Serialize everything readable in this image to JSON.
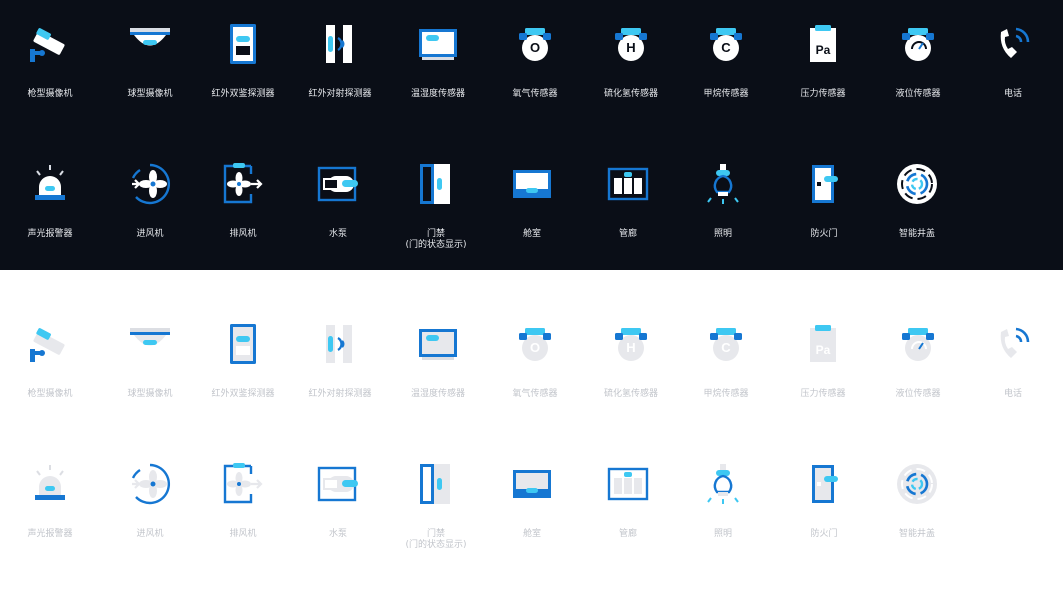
{
  "themes": {
    "dark": {
      "background": "#0a0e17",
      "neutral": "#ffffff",
      "neutral_soft": "#d9dde4",
      "blue": "#1677d2",
      "cyan": "#3ec8f2",
      "label_color": "#e6e8ec"
    },
    "light": {
      "background": "#ffffff",
      "neutral": "#e7e8ec",
      "neutral_soft": "#dcdee3",
      "blue": "#1677d2",
      "cyan": "#3ec8f2",
      "label_color": "#c2c5cb"
    }
  },
  "row_top": [
    {
      "icon": "gun-camera-icon",
      "label": "枪型摄像机"
    },
    {
      "icon": "dome-camera-icon",
      "label": "球型摄像机"
    },
    {
      "icon": "dual-infrared-detector-icon",
      "label": "红外双鉴探测器"
    },
    {
      "icon": "infrared-beam-detector-icon",
      "label": "红外对射探测器"
    },
    {
      "icon": "temperature-humidity-sensor-icon",
      "label": "温湿度传感器"
    },
    {
      "icon": "oxygen-sensor-icon",
      "label": "氧气传感器",
      "glyph": "O"
    },
    {
      "icon": "hydrogen-sulfide-sensor-icon",
      "label": "硫化氢传感器",
      "glyph": "H"
    },
    {
      "icon": "methane-sensor-icon",
      "label": "甲烷传感器",
      "glyph": "C"
    },
    {
      "icon": "pressure-sensor-icon",
      "label": "压力传感器",
      "glyph": "Pa"
    },
    {
      "icon": "level-sensor-icon",
      "label": "液位传感器"
    },
    {
      "icon": "telephone-icon",
      "label": "电话"
    }
  ],
  "row_bottom": [
    {
      "icon": "audible-visual-alarm-icon",
      "label": "声光报警器"
    },
    {
      "icon": "intake-fan-icon",
      "label": "进风机"
    },
    {
      "icon": "exhaust-fan-icon",
      "label": "排风机"
    },
    {
      "icon": "water-pump-icon",
      "label": "水泵"
    },
    {
      "icon": "access-door-icon",
      "label": "门禁",
      "sublabel": "(门的状态显示)"
    },
    {
      "icon": "cabin-icon",
      "label": "舱室"
    },
    {
      "icon": "pipe-gallery-icon",
      "label": "管廊"
    },
    {
      "icon": "lighting-icon",
      "label": "照明"
    },
    {
      "icon": "fire-door-icon",
      "label": "防火门"
    },
    {
      "icon": "smart-manhole-cover-icon",
      "label": "智能井盖"
    }
  ]
}
